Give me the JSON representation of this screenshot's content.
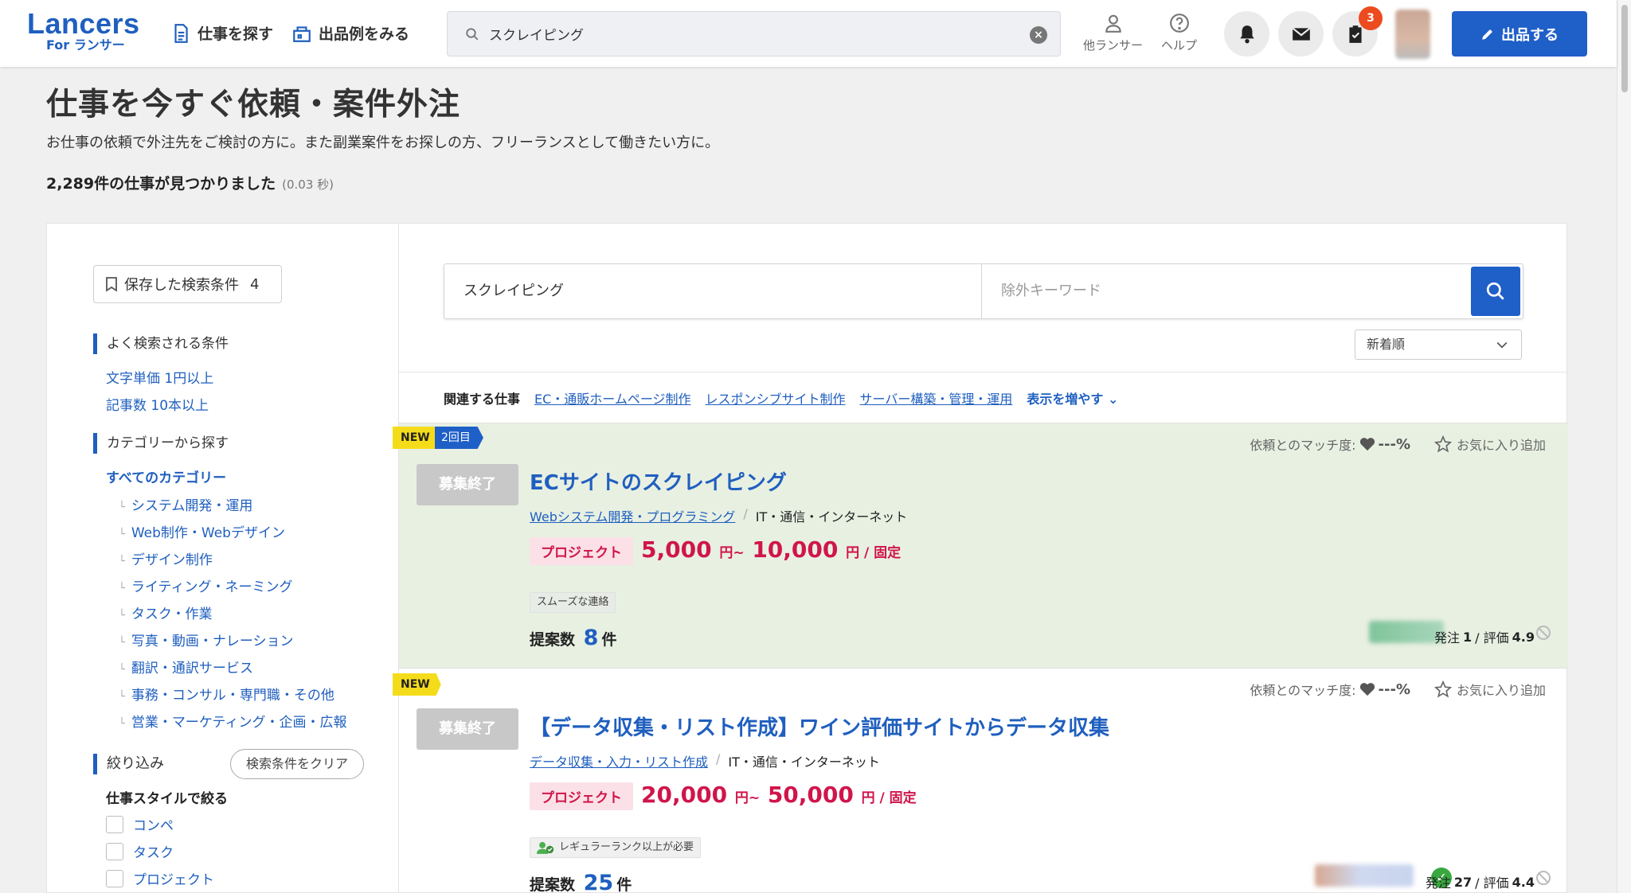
{
  "header": {
    "logo_main": "Lancers",
    "logo_sub": "For ランサー",
    "nav": [
      {
        "label": "仕事を探す",
        "icon": "document-icon"
      },
      {
        "label": "出品例をみる",
        "icon": "shop-bag-icon"
      }
    ],
    "search_value": "スクレイピング",
    "other_lancers": "他ランサー",
    "help": "ヘルプ",
    "task_badge": "3",
    "post_button": "出品する"
  },
  "page": {
    "title": "仕事を今すぐ依頼・案件外注",
    "description": "お仕事の依頼で外注先をご検討の方に。また副業案件をお探しの方、フリーランスとして働きたい方に。",
    "result_count": "2,289件の仕事が見つかりました",
    "result_time": "(0.03 秒)"
  },
  "sidebar": {
    "saved_label": "保存した検索条件",
    "saved_count": "4",
    "popular_heading": "よく検索される条件",
    "popular_links": [
      "文字単価 1円以上",
      "記事数 10本以上"
    ],
    "category_heading": "カテゴリーから探す",
    "all_categories": "すべてのカテゴリー",
    "categories": [
      "システム開発・運用",
      "Web制作・Webデザイン",
      "デザイン制作",
      "ライティング・ネーミング",
      "タスク・作業",
      "写真・動画・ナレーション",
      "翻訳・通訳サービス",
      "事務・コンサル・専門職・その他",
      "営業・マーケティング・企画・広報"
    ],
    "filter_heading": "絞り込み",
    "clear_button": "検索条件をクリア",
    "style_heading": "仕事スタイルで絞る",
    "styles": [
      "コンペ",
      "タスク",
      "プロジェクト"
    ]
  },
  "search": {
    "keyword": "スクレイピング",
    "exclude_placeholder": "除外キーワード",
    "sort": "新着順"
  },
  "related": {
    "label": "関連する仕事",
    "links": [
      "EC・通販ホームページ制作",
      "レスポンシブサイト制作",
      "サーバー構築・管理・運用"
    ],
    "more": "表示を増やす"
  },
  "jobs": [
    {
      "new_tag": "NEW",
      "round_tag": "2回目",
      "status": "募集終了",
      "match_label": "依頼とのマッチ度:",
      "match_value": "---%",
      "fav_label": "お気に入り追加",
      "title": "ECサイトのスクレイピング",
      "category_link": "Webシステム開発・プログラミング",
      "industry": "IT・通信・インターネット",
      "type_badge": "プロジェクト",
      "price_min": "5,000",
      "price_max": "10,000",
      "yen": "円",
      "tilde": "~",
      "price_suffix": "円 / 固定",
      "chip": "スムーズな連絡",
      "proposals_label": "提案数",
      "proposals_count": "8",
      "proposals_unit": "件",
      "orders_label": "発注",
      "orders_value": "1",
      "rating_label": "/ 評価",
      "rating_value": "4.9"
    },
    {
      "new_tag": "NEW",
      "status": "募集終了",
      "match_label": "依頼とのマッチ度:",
      "match_value": "---%",
      "fav_label": "お気に入り追加",
      "title": "【データ収集・リスト作成】ワイン評価サイトからデータ収集",
      "category_link": "データ収集・入力・リスト作成",
      "industry": "IT・通信・インターネット",
      "type_badge": "プロジェクト",
      "price_min": "20,000",
      "price_max": "50,000",
      "yen": "円",
      "tilde": "~",
      "price_suffix": "円 / 固定",
      "chip": "レギュラーランク以上が必要",
      "proposals_label": "提案数",
      "proposals_count": "25",
      "proposals_unit": "件",
      "orders_label": "発注",
      "orders_value": "27",
      "rating_label": "/ 評価",
      "rating_value": "4.4"
    }
  ],
  "colors": {
    "brand_blue": "#1f5fbf",
    "price_red": "#d0154a",
    "highlight_bg": "#e8f0e2",
    "new_yellow": "#f5dc1a"
  }
}
